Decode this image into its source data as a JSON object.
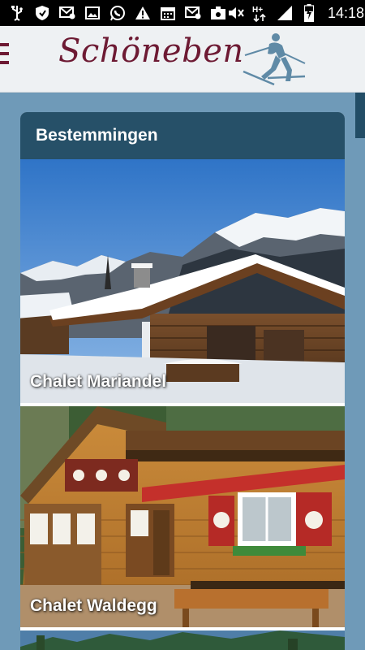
{
  "status_bar": {
    "time": "14:18",
    "left_icons": [
      "usb-icon",
      "shield-icon",
      "email-icon",
      "image-icon",
      "whatsapp-icon",
      "warning-icon",
      "calendar-icon",
      "email-icon",
      "upload-icon"
    ],
    "right_icons": [
      "mute-icon",
      "hplus-signal-icon",
      "signal-icon",
      "battery-charging-icon"
    ],
    "network_label": "H+"
  },
  "header": {
    "logo_text": "Schöneben",
    "brand_color": "#6d1a33"
  },
  "section": {
    "title": "Bestemmingen"
  },
  "cards": [
    {
      "name": "Chalet Mariandel"
    },
    {
      "name": "Chalet Waldegg"
    },
    {
      "name": ""
    }
  ],
  "colors": {
    "page_background": "#6f9ab8",
    "section_header": "#265068",
    "appbar": "#eef1f3"
  }
}
